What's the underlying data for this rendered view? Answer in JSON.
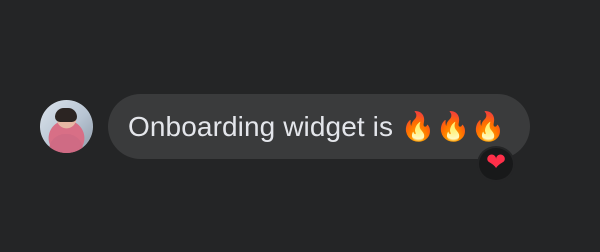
{
  "message": {
    "text": "Onboarding widget is 🔥🔥🔥",
    "reaction": "❤"
  },
  "colors": {
    "background": "#242526",
    "bubble": "#3a3b3c",
    "text": "#e4e6eb",
    "reaction": "#ff2f49"
  },
  "icons": {
    "reaction_icon": "heart-icon"
  }
}
